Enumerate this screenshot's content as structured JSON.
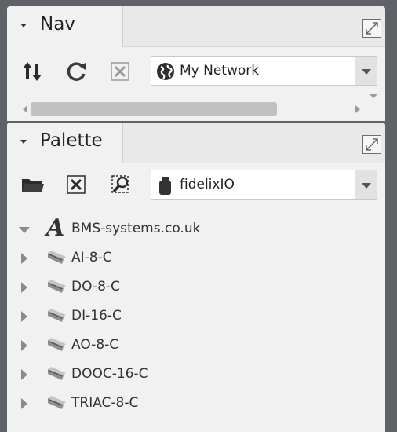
{
  "nav": {
    "title": "Nav",
    "select_value": "My Network"
  },
  "palette": {
    "title": "Palette",
    "select_value": "fidelixIO",
    "tree": {
      "root_label": "BMS-systems.co.uk",
      "items": [
        {
          "label": "AI-8-C"
        },
        {
          "label": "DO-8-C"
        },
        {
          "label": "DI-16-C"
        },
        {
          "label": "AO-8-C"
        },
        {
          "label": "DOOC-16-C"
        },
        {
          "label": "TRIAC-8-C"
        }
      ]
    }
  },
  "colors": {
    "background": "#5f6368",
    "panel": "#f1f1f1",
    "icon": "#2b2b2b",
    "icon_disabled": "#9b9b9b"
  }
}
